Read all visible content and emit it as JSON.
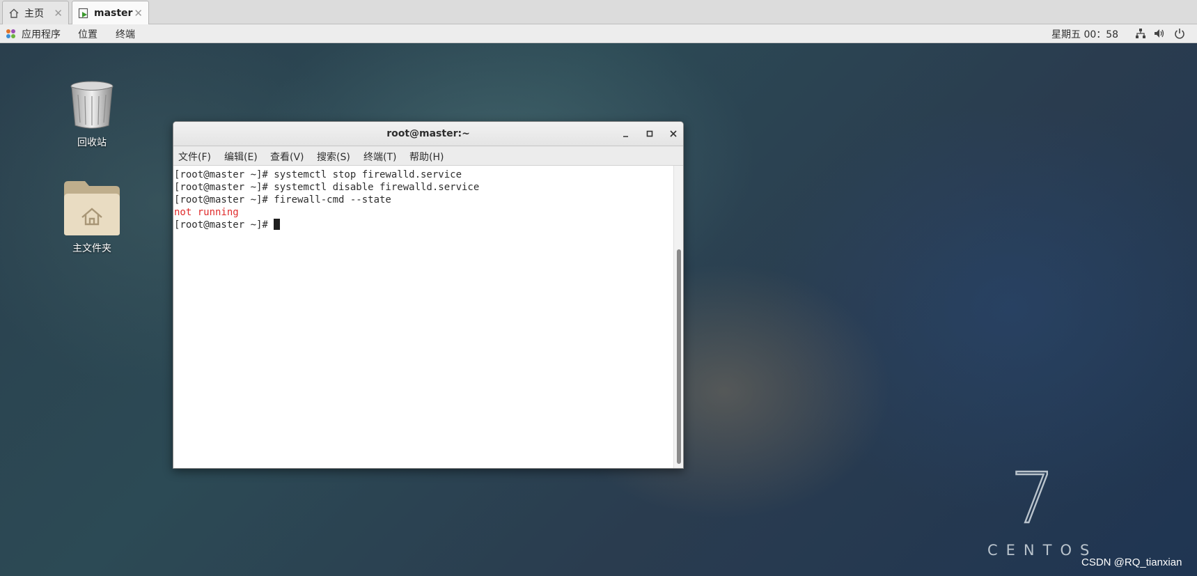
{
  "vm_tabs": [
    {
      "label": "主页",
      "icon": "home-icon",
      "close": "✕"
    },
    {
      "label": "master",
      "icon": "vm-running-icon",
      "close": "✕"
    }
  ],
  "panel": {
    "apps_menu": "应用程序",
    "places_menu": "位置",
    "terminal_menu": "终端",
    "clock": "星期五 00：58",
    "icons": [
      "network-icon",
      "volume-icon",
      "power-icon"
    ]
  },
  "desktop": {
    "icons": [
      {
        "label": "回收站",
        "icon": "trash-icon"
      },
      {
        "label": "主文件夹",
        "icon": "home-folder-icon"
      }
    ],
    "brand_number": "7",
    "brand_text": "CENTOS",
    "watermark": "CSDN @RQ_tianxian"
  },
  "terminal": {
    "title": "root@master:~",
    "controls": {
      "minimize": "_",
      "maximize": "□",
      "close": "✕"
    },
    "menu": [
      "文件(F)",
      "编辑(E)",
      "查看(V)",
      "搜索(S)",
      "终端(T)",
      "帮助(H)"
    ],
    "lines": [
      "[root@master ~]# systemctl stop firewalld.service",
      "[root@master ~]# systemctl disable firewalld.service",
      "[root@master ~]# firewall-cmd --state",
      "not running",
      "[root@master ~]# "
    ],
    "error_color": "#e02b2b"
  }
}
